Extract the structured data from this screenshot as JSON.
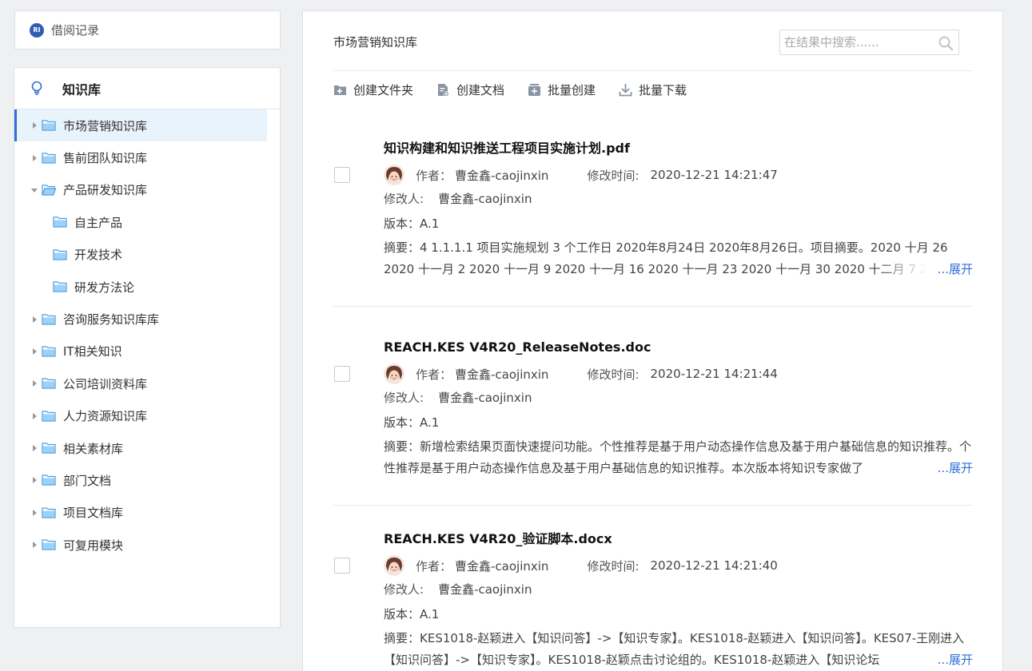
{
  "borrow": {
    "icon": "reading-record-icon",
    "icon_text": "RI",
    "label": "借阅记录"
  },
  "kb": {
    "title": "知识库",
    "items": [
      {
        "label": "市场营销知识库",
        "selected": true
      },
      {
        "label": "售前团队知识库"
      },
      {
        "label": "产品研发知识库",
        "expanded": true
      },
      {
        "label": "自主产品",
        "child": true
      },
      {
        "label": "开发技术",
        "child": true
      },
      {
        "label": "研发方法论",
        "child": true
      },
      {
        "label": "咨询服务知识库库"
      },
      {
        "label": "IT相关知识"
      },
      {
        "label": "公司培训资料库"
      },
      {
        "label": "人力资源知识库"
      },
      {
        "label": "相关素材库"
      },
      {
        "label": "部门文档"
      },
      {
        "label": "项目文档库"
      },
      {
        "label": "可复用模块"
      }
    ]
  },
  "main": {
    "title": "市场营销知识库",
    "search": {
      "placeholder": "在结果中搜索......"
    },
    "toolbar": {
      "create_folder": "创建文件夹",
      "create_doc": "创建文档",
      "batch_create": "批量创建",
      "batch_download": "批量下载"
    },
    "results": [
      {
        "title": "知识构建和知识推送工程项目实施计划.pdf",
        "author_label": "作者：",
        "author": "曹金鑫-caojinxin",
        "modified_time_label": "修改时间:",
        "modified_time": "2020-12-21 14:21:47",
        "modifier_label": "修改人:",
        "modifier": "曹金鑫-caojinxin",
        "version": "版本：A.1",
        "summary": "摘要：4 1.1.1.1 项目实施规划 3 个工作日 2020年8月24日 2020年8月26日。项目摘要。2020 十月 26 2020 十一月 2 2020 十一月 9 2020 十一月 16 2020 十一月 23 2020 十一月 30 2020 十二月 7 2020",
        "expand": "...展开"
      },
      {
        "title": "REACH.KES V4R20_ReleaseNotes.doc",
        "author_label": "作者：",
        "author": "曹金鑫-caojinxin",
        "modified_time_label": "修改时间:",
        "modified_time": "2020-12-21 14:21:44",
        "modifier_label": "修改人:",
        "modifier": "曹金鑫-caojinxin",
        "version": "版本：A.1",
        "summary": "摘要：新增检索结果页面快速提问功能。个性推荐是基于用户动态操作信息及基于用户基础信息的知识推荐。个性推荐是基于用户动态操作信息及基于用户基础信息的知识推荐。本次版本将知识专家做了",
        "expand": "...展开"
      },
      {
        "title": "REACH.KES V4R20_验证脚本.docx",
        "author_label": "作者：",
        "author": "曹金鑫-caojinxin",
        "modified_time_label": "修改时间:",
        "modified_time": "2020-12-21 14:21:40",
        "modifier_label": "修改人:",
        "modifier": "曹金鑫-caojinxin",
        "version": "版本：A.1",
        "summary": "摘要：KES1018-赵颖进入【知识问答】->【知识专家】。KES1018-赵颖进入【知识问答】。KES07-王刚进入【知识问答】->【知识专家】。KES1018-赵颖点击讨论组的。KES1018-赵颖进入【知识论坛",
        "expand": "...展开"
      }
    ]
  }
}
